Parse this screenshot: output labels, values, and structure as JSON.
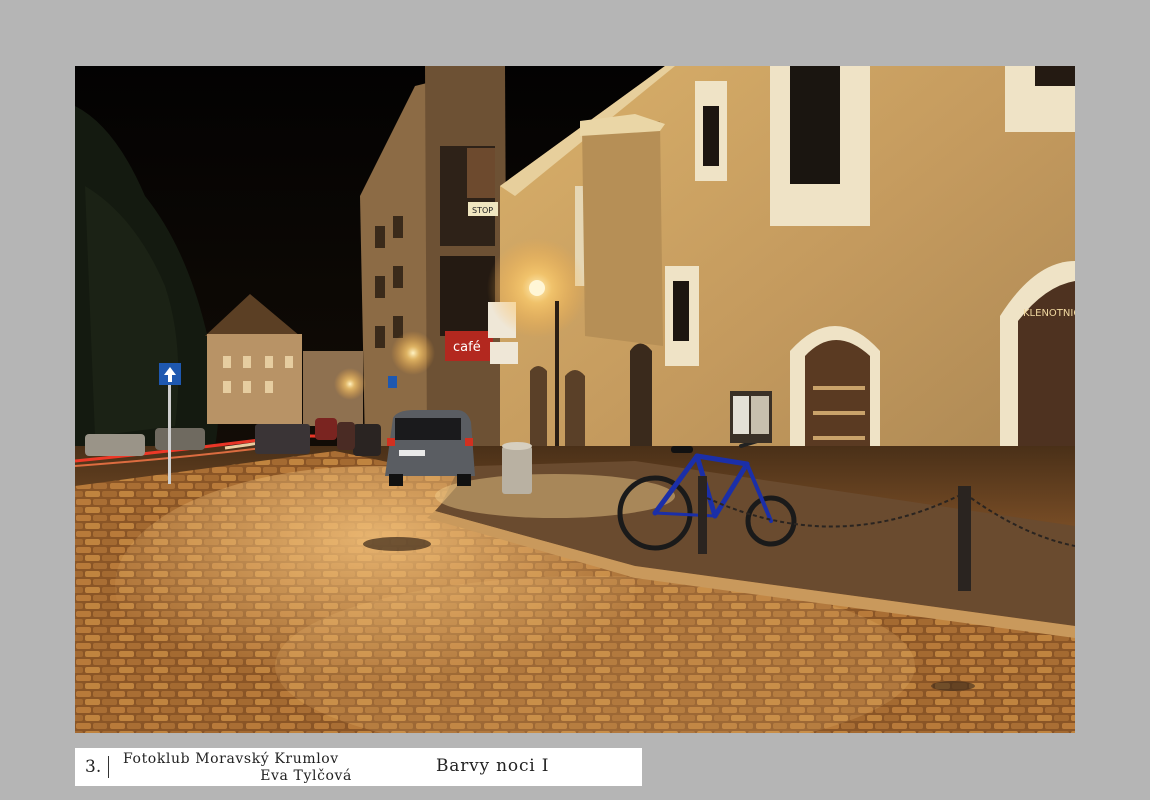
{
  "caption": {
    "number": "3.",
    "club": "Fotoklub Moravský Krumlov",
    "author": "Eva Tylčová",
    "title": "Barvy noci I"
  },
  "colors": {
    "background": "#b5b5b5",
    "sky": "#050403",
    "facade": "#c9a468",
    "cobble": "#a86a2e",
    "lamp": "#ffd27a"
  },
  "photo": {
    "signs": {
      "cafe": "café",
      "stop": "STOP",
      "shop": "KLENOTNICTVÍ"
    }
  }
}
